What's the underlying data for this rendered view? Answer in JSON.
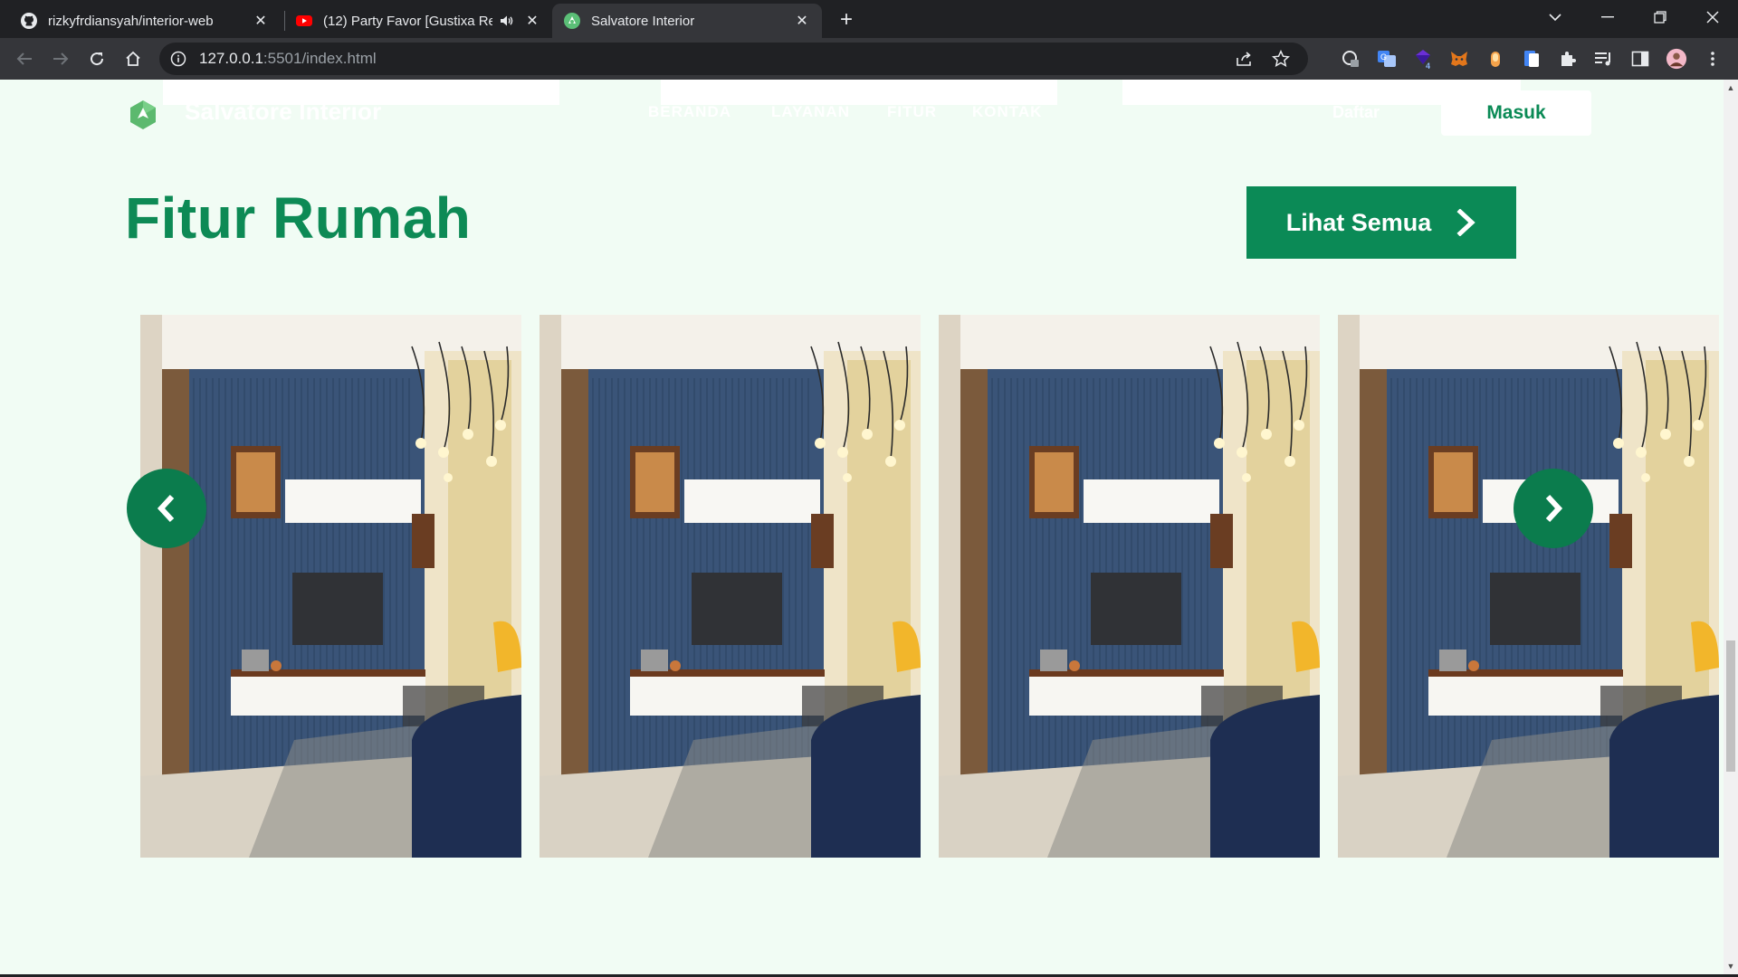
{
  "browser": {
    "tabs": [
      {
        "title": "rizkyfrdiansyah/interior-web",
        "icon": "github-icon",
        "active": false
      },
      {
        "title": "(12) Party Favor [Gustixa Rem",
        "icon": "youtube-icon",
        "active": false,
        "muted_indicator": "speaker-icon"
      },
      {
        "title": "Salvatore Interior",
        "icon": "salvatore-favicon-icon",
        "active": true
      }
    ],
    "url_host": "127.0.0.1",
    "url_rest": ":5501/index.html",
    "extension_badge": "4"
  },
  "header": {
    "brand": "Salvatore Interior",
    "nav": [
      "BERANDA",
      "LAYANAN",
      "FITUR",
      "KONTAK"
    ],
    "daftar_label": "Daftar",
    "masuk_label": "Masuk"
  },
  "section": {
    "title": "Fitur Rumah",
    "see_all_label": "Lihat Semua"
  },
  "colors": {
    "primary": "#0b8a56",
    "page_bg": "#f1fcf4",
    "wall": "#3a5478"
  },
  "carousel": {
    "items": [
      "living-room-photo",
      "living-room-photo",
      "living-room-photo",
      "living-room-photo"
    ],
    "prev_icon": "chevron-left-icon",
    "next_icon": "chevron-right-icon"
  }
}
